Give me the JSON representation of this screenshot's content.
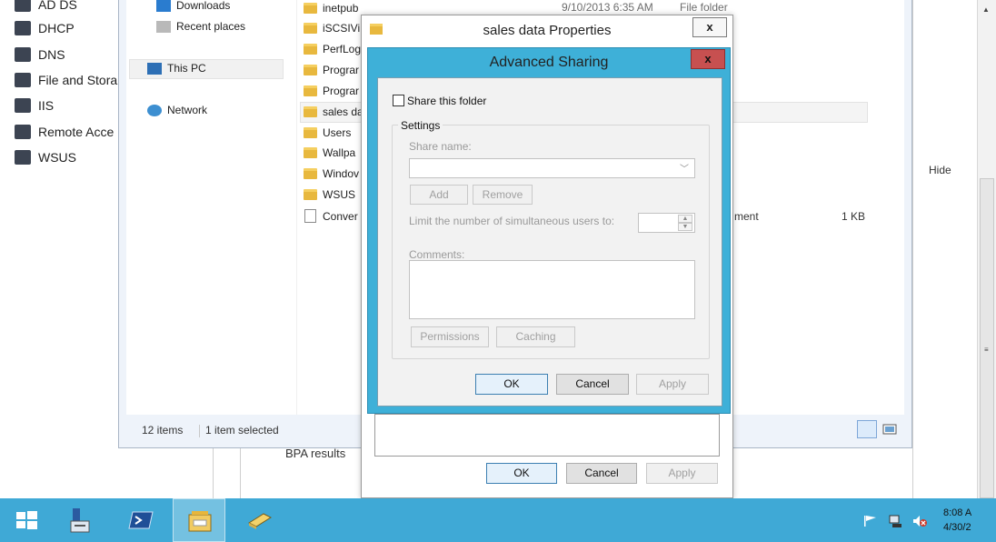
{
  "server_manager": {
    "nav_items": [
      {
        "label": "AD DS",
        "icon": "ad-ds-icon"
      },
      {
        "label": "DHCP",
        "icon": "dhcp-icon"
      },
      {
        "label": "DNS",
        "icon": "dns-icon"
      },
      {
        "label": "File and Stora",
        "icon": "file-storage-icon"
      },
      {
        "label": "IIS",
        "icon": "iis-icon"
      },
      {
        "label": "Remote Acce",
        "icon": "remote-access-icon"
      },
      {
        "label": "WSUS",
        "icon": "wsus-icon"
      }
    ],
    "hide_label": "Hide",
    "bpa_label": "BPA results"
  },
  "explorer": {
    "nav_pane": [
      {
        "label": "Downloads",
        "icon": "downloads-icon"
      },
      {
        "label": "Recent places",
        "icon": "recent-places-icon"
      },
      {
        "label": "This PC",
        "icon": "this-pc-icon"
      },
      {
        "label": "Network",
        "icon": "network-icon"
      }
    ],
    "files": [
      {
        "name": "inetpub",
        "type": "folder"
      },
      {
        "name": "iSCSIVi",
        "type": "folder"
      },
      {
        "name": "PerfLog",
        "type": "folder"
      },
      {
        "name": "Prograr",
        "type": "folder"
      },
      {
        "name": "Prograr",
        "type": "folder"
      },
      {
        "name": "sales da",
        "type": "folder",
        "selected": true
      },
      {
        "name": "Users",
        "type": "folder"
      },
      {
        "name": "Wallpa",
        "type": "folder"
      },
      {
        "name": "Windov",
        "type": "folder"
      },
      {
        "name": "WSUS",
        "type": "folder"
      },
      {
        "name": "Conver",
        "type": "document"
      }
    ],
    "first_row_date": "9/10/2013 6:35 AM",
    "first_row_type": "File folder",
    "doc_type_fragment": "ment",
    "doc_size": "1 KB",
    "status_items": "12 items",
    "status_selected": "1 item selected"
  },
  "properties_dialog": {
    "title": "sales data Properties",
    "close": "x",
    "ok": "OK",
    "cancel": "Cancel",
    "apply": "Apply"
  },
  "advanced_sharing": {
    "title": "Advanced Sharing",
    "close": "x",
    "share_checkbox_label": "Share this folder",
    "share_checked": false,
    "settings_label": "Settings",
    "share_name_label": "Share name:",
    "share_name_value": "",
    "add": "Add",
    "remove": "Remove",
    "limit_label": "Limit the number of simultaneous users to:",
    "limit_value": "",
    "comments_label": "Comments:",
    "comments_value": "",
    "permissions": "Permissions",
    "caching": "Caching",
    "ok": "OK",
    "cancel": "Cancel",
    "apply": "Apply"
  },
  "taskbar": {
    "clock_time": "8:08 A",
    "clock_date": "4/30/2",
    "accent": "#3fa9d6"
  }
}
